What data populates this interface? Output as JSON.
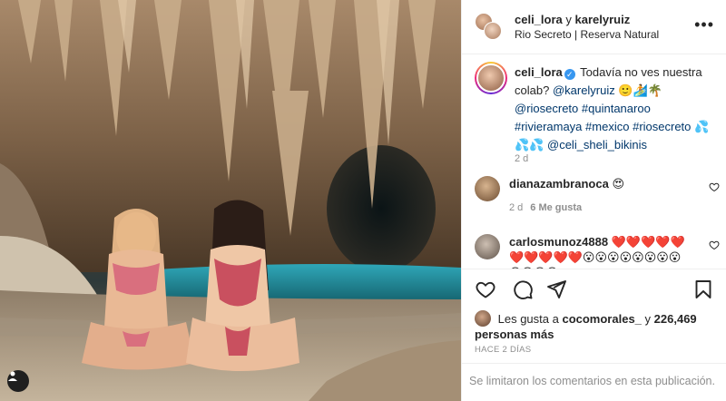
{
  "header": {
    "user1": "celi_lora",
    "conjunction": "y",
    "user2": "karelyruiz",
    "location": "Rio Secreto | Reserva Natural",
    "more_icon": "more-horizontal-icon"
  },
  "caption": {
    "username": "celi_lora",
    "verified_icon": "verified-badge-icon",
    "text_1": "Todavía no ves nuestra colab?",
    "mention_karely": "@karelyruiz",
    "emojis_1": "🙂🏄🌴",
    "tag_riosecreto_1": "@riosecreto",
    "tag_quintanaroo": "#quintanaroo",
    "tag_rivieramaya": "#rivieramaya",
    "tag_mexico": "#mexico",
    "tag_riosecreto_2": "#riosecreto",
    "emojis_2": "💦💦💦",
    "mention_celisheli": "@celi_sheli_bikinis",
    "time": "2 d"
  },
  "comments": [
    {
      "username": "dianazambranoca",
      "text": "😍",
      "time": "2 d",
      "likes": "6 Me gusta"
    },
    {
      "username": "carlosmunoz4888",
      "text": "❤️❤️❤️❤️❤️❤️❤️❤️❤️❤️😮😮😮😮😮😮😮😮😍😍😍😍"
    }
  ],
  "likes": {
    "prefix": "Les gusta a",
    "user": "cocomorales_",
    "conjunction": "y",
    "count": "226,469 personas más"
  },
  "date": "HACE 2 DÍAS",
  "footer": "Se limitaron los comentarios en esta publicación.",
  "colors": {
    "link": "#00376b",
    "muted": "#8e8e8e",
    "border": "#efefef",
    "verified": "#3897f0"
  }
}
